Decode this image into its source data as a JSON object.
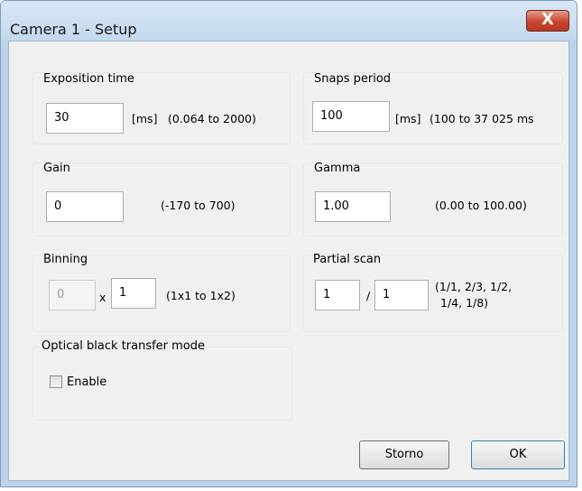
{
  "window": {
    "title": "Camera 1 - Setup",
    "close_glyph": "X"
  },
  "exposure": {
    "label": "Exposition time",
    "value": "30",
    "unit": "[ms]",
    "range": "(0.064 to 2000)"
  },
  "snaps": {
    "label": "Snaps period",
    "value": "100",
    "unit": "[ms]",
    "range": "(100 to 37 025 ms"
  },
  "gain": {
    "label": "Gain",
    "value": "0",
    "range": "(-170 to 700)"
  },
  "gamma": {
    "label": "Gamma",
    "value": "1.00",
    "range": "(0.00 to 100.00)"
  },
  "binning": {
    "label": "Binning",
    "value_x": "0",
    "separator": "x",
    "value_y": "1",
    "range": "(1x1 to 1x2)"
  },
  "partial_scan": {
    "label": "Partial scan",
    "numerator": "1",
    "separator": "/",
    "denominator": "1",
    "options_line1": "(1/1, 2/3, 1/2,",
    "options_line2": "1/4, 1/8)"
  },
  "optical_black": {
    "label": "Optical black transfer mode",
    "enable_label": "Enable",
    "enabled": false
  },
  "buttons": {
    "cancel": "Storno",
    "ok": "OK"
  },
  "icons": {
    "close": "close-icon"
  }
}
